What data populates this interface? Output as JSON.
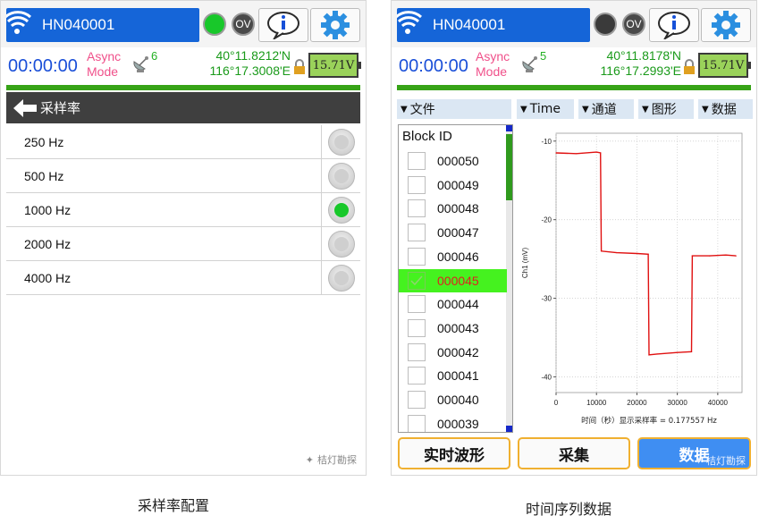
{
  "left_screen": {
    "device_name": "HN040001",
    "ov_label": "OV",
    "timer": "00:00:00",
    "async_line1": "Async",
    "async_line2": "Mode",
    "satellites": "6",
    "lat": "40°11.8212'N",
    "lon": "116°17.3008'E",
    "battery": "15.71V",
    "status_led_color": "#18c82a",
    "page_title": "采样率",
    "rates": [
      {
        "label": "250 Hz",
        "selected": false
      },
      {
        "label": "500 Hz",
        "selected": false
      },
      {
        "label": "1000 Hz",
        "selected": true
      },
      {
        "label": "2000 Hz",
        "selected": false
      },
      {
        "label": "4000 Hz",
        "selected": false
      }
    ],
    "watermark": "桔灯勘探"
  },
  "right_screen": {
    "device_name": "HN040001",
    "ov_label": "OV",
    "timer": "00:00:00",
    "async_line1": "Async",
    "async_line2": "Mode",
    "satellites": "5",
    "lat": "40°11.8178'N",
    "lon": "116°17.2993'E",
    "battery": "15.71V",
    "status_led_color": "#3a3a3a",
    "menus": [
      "文件",
      "Time",
      "通道",
      "图形",
      "数据"
    ],
    "block_header": "Block ID",
    "blocks": [
      "000050",
      "000049",
      "000048",
      "000047",
      "000046",
      "000045",
      "000044",
      "000043",
      "000042",
      "000041",
      "000040",
      "000039"
    ],
    "selected_block": "000045",
    "buttons": [
      "实时波形",
      "采集",
      "数据"
    ],
    "active_button": "数据",
    "watermark": "桔灯勘探"
  },
  "captions": {
    "left": "采样率配置",
    "right": "时间序列数据"
  },
  "chart_data": {
    "type": "line",
    "title": "",
    "xlabel": "时间（秒）显示采样率 = 0.177557 Hz",
    "ylabel": "Ch1 (mV)",
    "xlim": [
      0,
      46000
    ],
    "ylim": [
      -42,
      -9
    ],
    "x_ticks": [
      0,
      10000,
      20000,
      30000,
      40000
    ],
    "y_ticks": [
      -10,
      -20,
      -30,
      -40
    ],
    "grid": true,
    "series": [
      {
        "color": "#e01010",
        "x": [
          0,
          5000,
          10000,
          11000,
          11200,
          15000,
          20000,
          22800,
          23000,
          25000,
          30000,
          33500,
          33700,
          38000,
          42000,
          44500
        ],
        "y": [
          -11.5,
          -11.6,
          -11.4,
          -11.5,
          -24.0,
          -24.2,
          -24.3,
          -24.4,
          -37.2,
          -37.1,
          -36.9,
          -36.8,
          -24.6,
          -24.6,
          -24.5,
          -24.6
        ]
      }
    ]
  }
}
